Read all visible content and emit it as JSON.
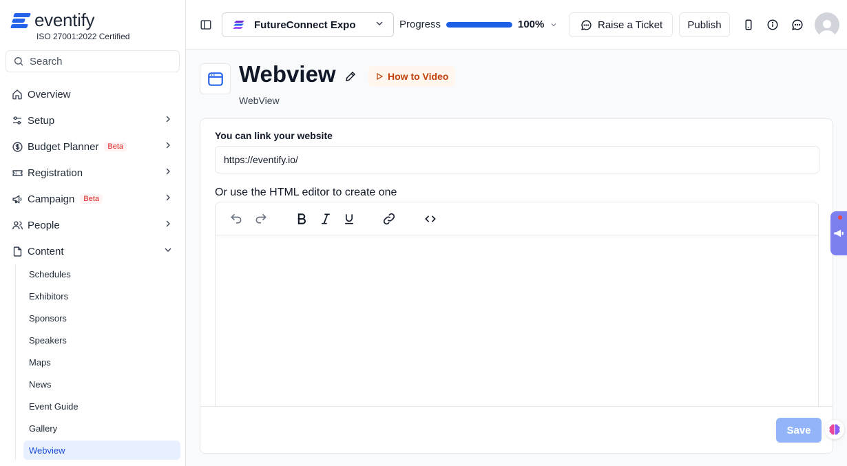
{
  "brand": {
    "name": "eventify",
    "certification": "ISO 27001:2022 Certified",
    "accent": "#2563eb"
  },
  "search": {
    "placeholder": "Search"
  },
  "sidebar": {
    "items": [
      {
        "label": "Overview",
        "icon": "home-icon"
      },
      {
        "label": "Setup",
        "icon": "sliders-icon"
      },
      {
        "label": "Budget Planner",
        "icon": "dollar-circle-icon",
        "badge": "Beta"
      },
      {
        "label": "Registration",
        "icon": "ticket-icon"
      },
      {
        "label": "Campaign",
        "icon": "megaphone-icon",
        "badge": "Beta"
      },
      {
        "label": "People",
        "icon": "users-icon"
      },
      {
        "label": "Content",
        "icon": "file-icon",
        "expanded": true
      }
    ],
    "content_sub": [
      "Schedules",
      "Exhibitors",
      "Sponsors",
      "Speakers",
      "Maps",
      "News",
      "Event Guide",
      "Gallery",
      "Webview"
    ],
    "active": "Webview"
  },
  "header": {
    "event_name": "FutureConnect Expo",
    "progress_label": "Progress",
    "progress_value": "100%",
    "progress_fraction": 1.0,
    "raise_ticket": "Raise a Ticket",
    "publish": "Publish"
  },
  "page": {
    "title": "Webview",
    "subtitle": "WebView",
    "how_to_video": "How to Video"
  },
  "form": {
    "url_label": "You can link your website",
    "url_value": "https://eventify.io/",
    "editor_label": "Or use the HTML editor to create one",
    "save": "Save"
  },
  "colors": {
    "active_bg": "#e8effe",
    "active_text": "#1d4ed8",
    "beta": "#dc2626",
    "howto": "#c2410c",
    "save_disabled": "#93b4f9",
    "progress": "#1d5fe5"
  }
}
